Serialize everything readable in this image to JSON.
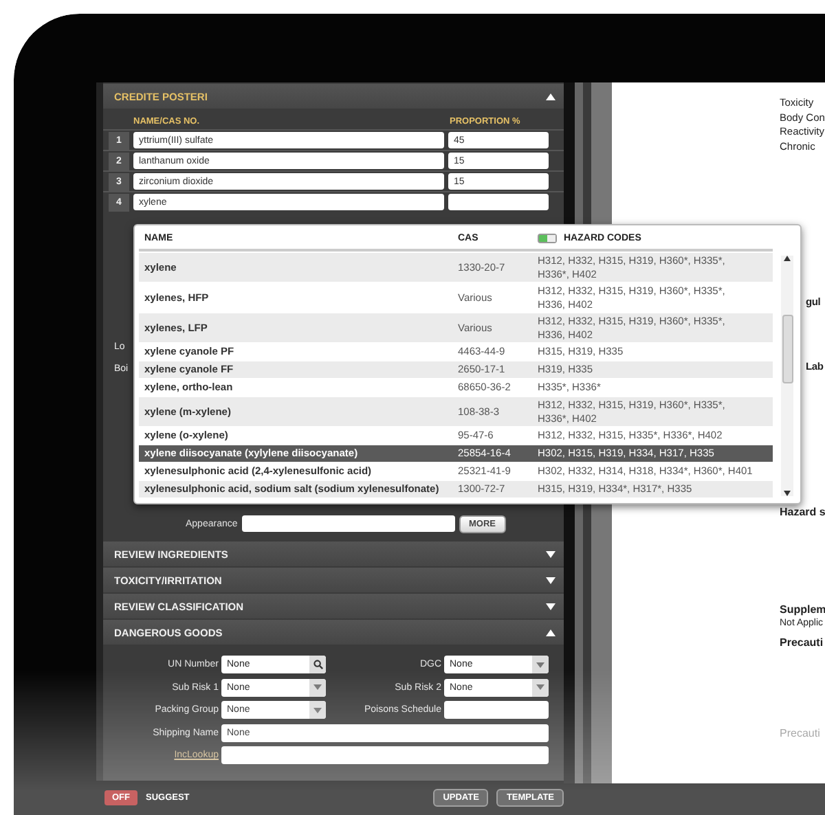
{
  "panel": {
    "title": "CREDITE POSTERI",
    "expanded": true,
    "columns": [
      "NAME/CAS NO.",
      "PROPORTION %"
    ],
    "ingredients": [
      {
        "index": "1",
        "name": "yttrium(III) sulfate",
        "proportion": "45"
      },
      {
        "index": "2",
        "name": "lanthanum oxide",
        "proportion": "15"
      },
      {
        "index": "3",
        "name": "zirconium dioxide",
        "proportion": "15"
      },
      {
        "index": "4",
        "name": "xylene"
      }
    ],
    "partial_labels": [
      "Lo",
      "Boi"
    ],
    "appearance": {
      "label": "Appearance",
      "button": "MORE"
    }
  },
  "autocomplete": {
    "columns": [
      "NAME",
      "CAS",
      "HAZARD CODES"
    ],
    "hazard_toggle_on": true,
    "rows": [
      {
        "name": "xylene",
        "cas": "1330-20-7",
        "hazards": "H312, H332, H315, H319, H360*, H335*, H336*, H402",
        "selected": false
      },
      {
        "name": "xylenes, HFP",
        "cas": "Various",
        "hazards": "H312, H332, H315, H319, H360*, H335*, H336, H402",
        "selected": false
      },
      {
        "name": "xylenes, LFP",
        "cas": "Various",
        "hazards": "H312, H332, H315, H319, H360*, H335*, H336, H402",
        "selected": false
      },
      {
        "name": "xylene cyanole PF",
        "cas": "4463-44-9",
        "hazards": "H315, H319, H335",
        "selected": false
      },
      {
        "name": "xylene cyanole FF",
        "cas": "2650-17-1",
        "hazards": "H319, H335",
        "selected": false
      },
      {
        "name": "xylene, ortho-lean",
        "cas": "68650-36-2",
        "hazards": "H335*, H336*",
        "selected": false
      },
      {
        "name": "xylene (m-xylene)",
        "cas": "108-38-3",
        "hazards": "H312, H332, H315, H319, H360*, H335*, H336*, H402",
        "selected": false
      },
      {
        "name": "xylene (o-xylene)",
        "cas": "95-47-6",
        "hazards": "H312, H332, H315, H335*, H336*, H402",
        "selected": false
      },
      {
        "name": "xylene diisocyanate (xylylene diisocyanate)",
        "cas": "25854-16-4",
        "hazards": "H302, H315, H319, H334, H317, H335",
        "selected": true
      },
      {
        "name": "xylenesulphonic acid (2,4-xylenesulfonic acid)",
        "cas": "25321-41-9",
        "hazards": "H302, H332, H314, H318, H334*, H360*, H401",
        "selected": false
      },
      {
        "name": "xylenesulphonic acid, sodium salt (sodium xylenesulfonate)",
        "cas": "1300-72-7",
        "hazards": "H315, H319, H334*, H317*, H335",
        "selected": false
      }
    ]
  },
  "sections": [
    {
      "title": "REVIEW INGREDIENTS",
      "expanded": false
    },
    {
      "title": "TOXICITY/IRRITATION",
      "expanded": false
    },
    {
      "title": "REVIEW CLASSIFICATION",
      "expanded": false
    },
    {
      "title": "DANGEROUS GOODS",
      "expanded": true
    }
  ],
  "dangerous_goods": {
    "fields": [
      {
        "label": "UN Number",
        "kind": "search",
        "value": "None"
      },
      {
        "label": "DGC",
        "kind": "select",
        "value": "None"
      },
      {
        "label": "Sub Risk 1",
        "kind": "select",
        "value": "None"
      },
      {
        "label": "Sub Risk 2",
        "kind": "select",
        "value": "None"
      },
      {
        "label": "Packing Group",
        "kind": "select",
        "value": "None"
      },
      {
        "label": "Poisons Schedule",
        "kind": "text"
      },
      {
        "label": "Shipping Name",
        "kind": "wide",
        "value": "None"
      },
      {
        "label": "IncLookup",
        "kind": "link-wide"
      }
    ]
  },
  "footer": {
    "suggest_toggle": {
      "on": false,
      "label": "OFF"
    },
    "suggest_label": "SUGGEST",
    "buttons": [
      "UPDATE",
      "TEMPLATE"
    ]
  },
  "document": {
    "lines": [
      "Toxicity",
      "Body Con",
      "Reactivity",
      "Chronic"
    ],
    "sections": [
      {
        "heading": "gul",
        "kind": "sub"
      },
      {
        "heading": "Lab",
        "kind": "sub"
      },
      {
        "heading": "Hazard s",
        "kind": "main"
      },
      {
        "heading": "Supplem",
        "kind": "main",
        "text": "Not Applic"
      },
      {
        "heading": "Precauti",
        "kind": "main"
      },
      {
        "heading": "Precauti",
        "kind": "muted"
      }
    ]
  }
}
